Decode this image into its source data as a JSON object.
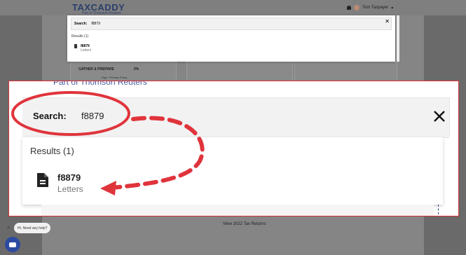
{
  "app": {
    "logo": "TAXCADDY",
    "logo_tagline": "Part of Thomson Reuters",
    "user_name": "Tom Taxpayer",
    "user_menu_caret": "▾"
  },
  "background": {
    "gather_prepare_label": "GATHER & PREPARE",
    "gather_prepare_percent": "0%",
    "gather_sub": "Sign · Privacy Policy",
    "bottom_text": "View 2022 Tax Returns"
  },
  "mini_search": {
    "label": "Search:",
    "value": "f8879",
    "results_heading": "Results (1)",
    "result_title": "f8879",
    "result_subtitle": "Letters"
  },
  "zoom": {
    "link_text": "Part of Thomson Reuters",
    "search_label": "Search:",
    "search_value": "f8879",
    "results_heading": "Results (1)",
    "result_title": "f8879",
    "result_subtitle": "Letters"
  },
  "chat": {
    "close": "×",
    "bubble_text": "Hi. Need any help?"
  },
  "colors": {
    "annotation_red": "#e0343c",
    "brand_navy": "#2a3f6c",
    "chat_blue": "#2c4aa0"
  },
  "icons": [
    "document-icon",
    "close-icon",
    "bell-icon",
    "chat-icon"
  ]
}
